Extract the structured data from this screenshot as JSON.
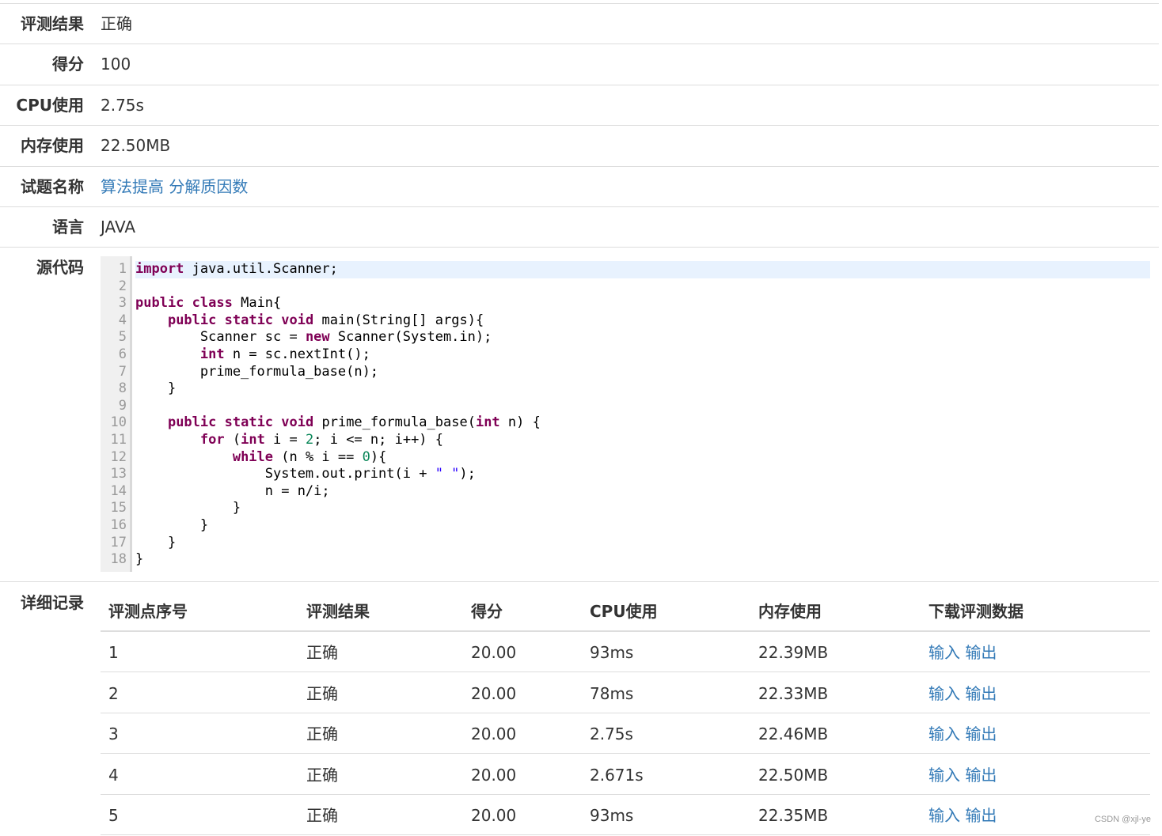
{
  "summary": [
    {
      "label": "评测结果",
      "value": "正确",
      "link": false
    },
    {
      "label": "得分",
      "value": "100",
      "link": false
    },
    {
      "label": "CPU使用",
      "value": "2.75s",
      "link": false
    },
    {
      "label": "内存使用",
      "value": "22.50MB",
      "link": false
    },
    {
      "label": "试题名称",
      "value": "算法提高 分解质因数",
      "link": true
    },
    {
      "label": "语言",
      "value": "JAVA",
      "link": false
    }
  ],
  "source": {
    "label": "源代码",
    "highlighted_line": 1,
    "lines": [
      "import java.util.Scanner;",
      "",
      "public class Main{",
      "    public static void main(String[] args){",
      "        Scanner sc = new Scanner(System.in);",
      "        int n = sc.nextInt();",
      "        prime_formula_base(n);",
      "    }",
      "",
      "    public static void prime_formula_base(int n) {",
      "        for (int i = 2; i <= n; i++) {",
      "            while (n % i == 0){",
      "                System.out.print(i + \" \");",
      "                n = n/i;",
      "            }",
      "        }",
      "    }",
      "}"
    ]
  },
  "details": {
    "label": "详细记录",
    "headers": [
      "评测点序号",
      "评测结果",
      "得分",
      "CPU使用",
      "内存使用",
      "下载评测数据"
    ],
    "rows": [
      [
        "1",
        "正确",
        "20.00",
        "93ms",
        "22.39MB"
      ],
      [
        "2",
        "正确",
        "20.00",
        "78ms",
        "22.33MB"
      ],
      [
        "3",
        "正确",
        "20.00",
        "2.75s",
        "22.46MB"
      ],
      [
        "4",
        "正确",
        "20.00",
        "2.671s",
        "22.50MB"
      ],
      [
        "5",
        "正确",
        "20.00",
        "93ms",
        "22.35MB"
      ]
    ],
    "download_input": "输入",
    "download_output": "输出"
  },
  "watermark": "CSDN @xjl-ye",
  "colors": {
    "link": "#337ab7",
    "keyword": "#7f0055",
    "border": "#dddddd"
  }
}
